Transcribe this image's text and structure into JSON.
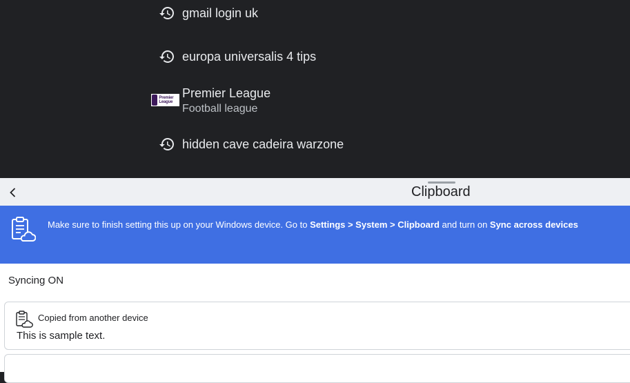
{
  "suggestions": {
    "items": [
      {
        "text": "gmail login uk",
        "icon": "history-icon"
      },
      {
        "text": "europa universalis 4 tips",
        "icon": "history-icon"
      },
      {
        "title": "Premier League",
        "subtitle": "Football league",
        "icon": "premier-league-logo",
        "logo_text": "Premier League"
      },
      {
        "text": "hidden cave cadeira warzone",
        "icon": "history-icon"
      }
    ]
  },
  "clipboard": {
    "title": "Clipboard",
    "back_icon": "chevron-left-icon",
    "banner": {
      "text_1": "Make sure to finish setting this up on your Windows device. Go to ",
      "settings_path": "Settings > System > Clipboard",
      "text_2": " and turn on ",
      "sync_label": "Sync across devices",
      "color": "#3f6fe3"
    },
    "sync_status": "Syncing ON",
    "entries": [
      {
        "source": "Copied from another device",
        "content": "This is sample text."
      }
    ]
  }
}
